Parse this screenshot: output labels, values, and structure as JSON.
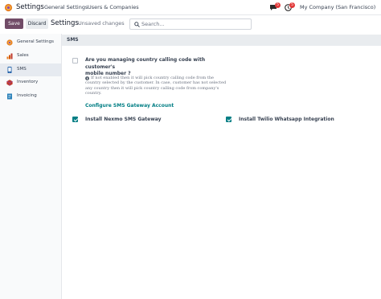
{
  "navbar": {
    "app_name": "Settings",
    "menu": [
      "General Settings",
      "Users & Companies"
    ],
    "chat_badge": "5",
    "activity_badge": "5",
    "company": "My Company (San Francisco)"
  },
  "control_panel": {
    "save_label": "Save",
    "discard_label": "Discard",
    "breadcrumb": "Settings",
    "status": "Unsaved changes",
    "search_placeholder": "Search..."
  },
  "sidebar": {
    "items": [
      {
        "label": "General Settings",
        "icon": "general-settings-icon",
        "active": false
      },
      {
        "label": "Sales",
        "icon": "sales-icon",
        "active": false
      },
      {
        "label": "SMS",
        "icon": "sms-icon",
        "active": true
      },
      {
        "label": "Inventory",
        "icon": "inventory-icon",
        "active": false
      },
      {
        "label": "Invoicing",
        "icon": "invoicing-icon",
        "active": false
      }
    ]
  },
  "content": {
    "section_title": "SMS",
    "country_code": {
      "title_line1": "Are you managing country calling code with customer's",
      "title_line2": "mobile number ?",
      "desc_lines": [
        "If not enabled then it will pick country calling code from the",
        "country selected by the customer. In case, customer has not selected",
        "any country then it will pick country calling code from company's",
        "country."
      ],
      "checked": false
    },
    "gateway_link": "Configure SMS Gateway Account",
    "nexmo": {
      "label": "Install Nexmo SMS Gateway",
      "checked": true
    },
    "twilio": {
      "label": "Install Twilio Whatsapp Integration",
      "checked": true
    }
  },
  "colors": {
    "primary": "#714b67",
    "accent": "#017e84",
    "badge": "#e23b3b"
  }
}
